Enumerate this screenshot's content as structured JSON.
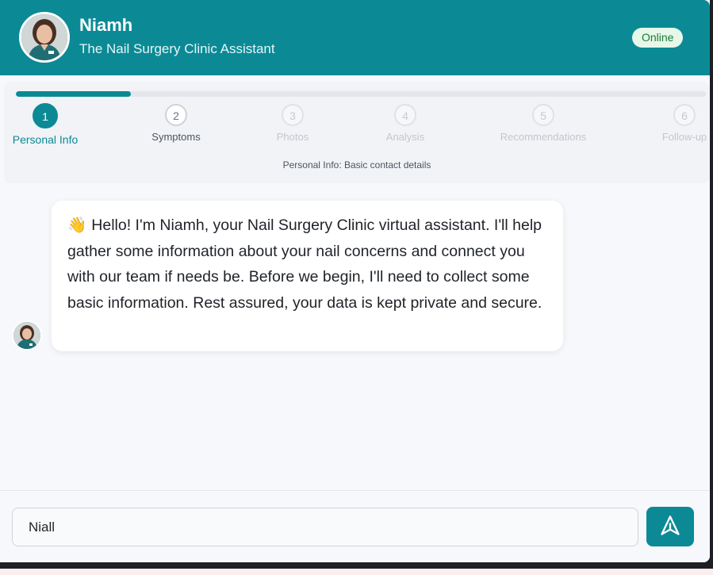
{
  "header": {
    "name": "Niamh",
    "subtitle": "The Nail Surgery Clinic Assistant",
    "status": "Online",
    "status_color": "#1f7a38",
    "brand_color": "#0b8a96"
  },
  "progress": {
    "percent": 16.7
  },
  "steps": [
    {
      "number": "1",
      "label": "Personal Info",
      "state": "active"
    },
    {
      "number": "2",
      "label": "Symptoms",
      "state": "next"
    },
    {
      "number": "3",
      "label": "Photos",
      "state": "future"
    },
    {
      "number": "4",
      "label": "Analysis",
      "state": "future"
    },
    {
      "number": "5",
      "label": "Recommendations",
      "state": "future"
    },
    {
      "number": "6",
      "label": "Follow-up",
      "state": "future"
    }
  ],
  "step_description": "Personal Info: Basic contact details",
  "messages": [
    {
      "sender": "assistant",
      "emoji": "👋",
      "text": "Hello! I'm Niamh, your Nail Surgery Clinic virtual assistant. I'll help gather some information about your nail concerns and connect you with our team if needs be. Before we begin, I'll need to collect some basic information. Rest assured, your data is kept private and secure."
    }
  ],
  "composer": {
    "value": "Niall",
    "send_icon": "send-icon"
  }
}
